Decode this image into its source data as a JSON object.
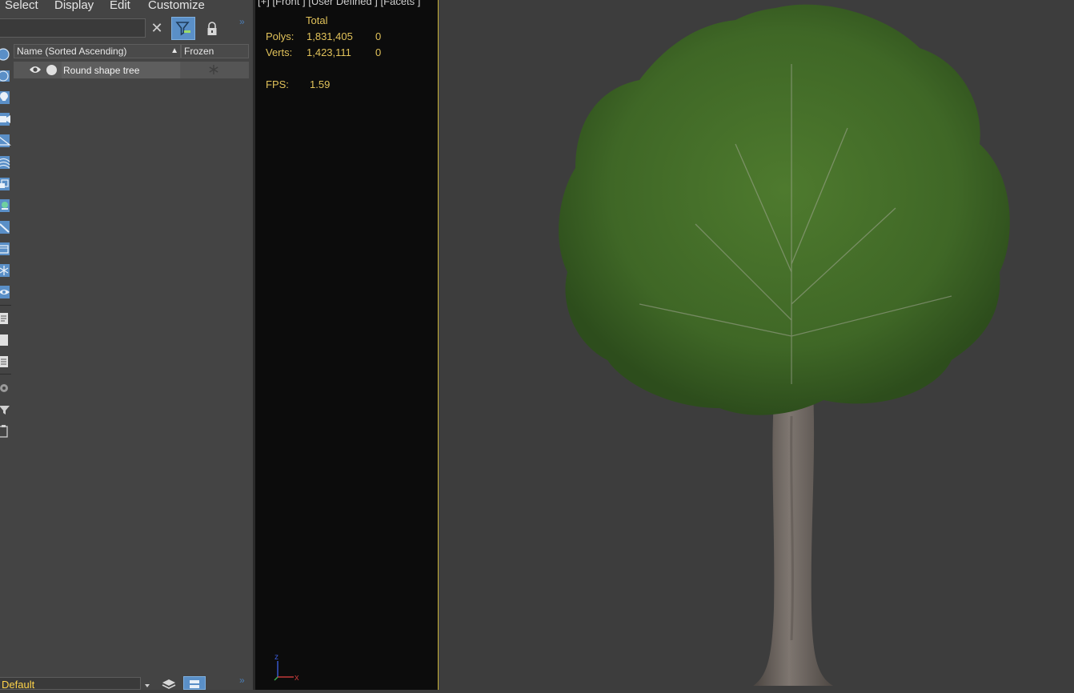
{
  "menu": {
    "items": [
      "Select",
      "Display",
      "Edit",
      "Customize"
    ]
  },
  "explorer": {
    "search": {
      "value": "",
      "placeholder": ""
    },
    "columns": {
      "name": "Name (Sorted Ascending)",
      "frozen": "Frozen"
    },
    "rows": [
      {
        "name": "Round shape tree"
      }
    ],
    "layer_dropdown": {
      "value": "Default"
    }
  },
  "viewport": {
    "label": "[+] [Front ] [User Defined ] [Facets ]",
    "stats": {
      "header": "Total",
      "polys_label": "Polys:",
      "polys_total": "1,831,405",
      "polys_sel": "0",
      "verts_label": "Verts:",
      "verts_total": "1,423,111",
      "verts_sel": "0",
      "fps_label": "FPS:",
      "fps_value": "1.59"
    },
    "axis": {
      "x": "x",
      "z": "z"
    }
  },
  "colors": {
    "accent_blue": "#5a8fc7",
    "stats_text": "#e1c25a",
    "viewport_border": "#c9b23a",
    "layer_text": "#ffd44a"
  }
}
